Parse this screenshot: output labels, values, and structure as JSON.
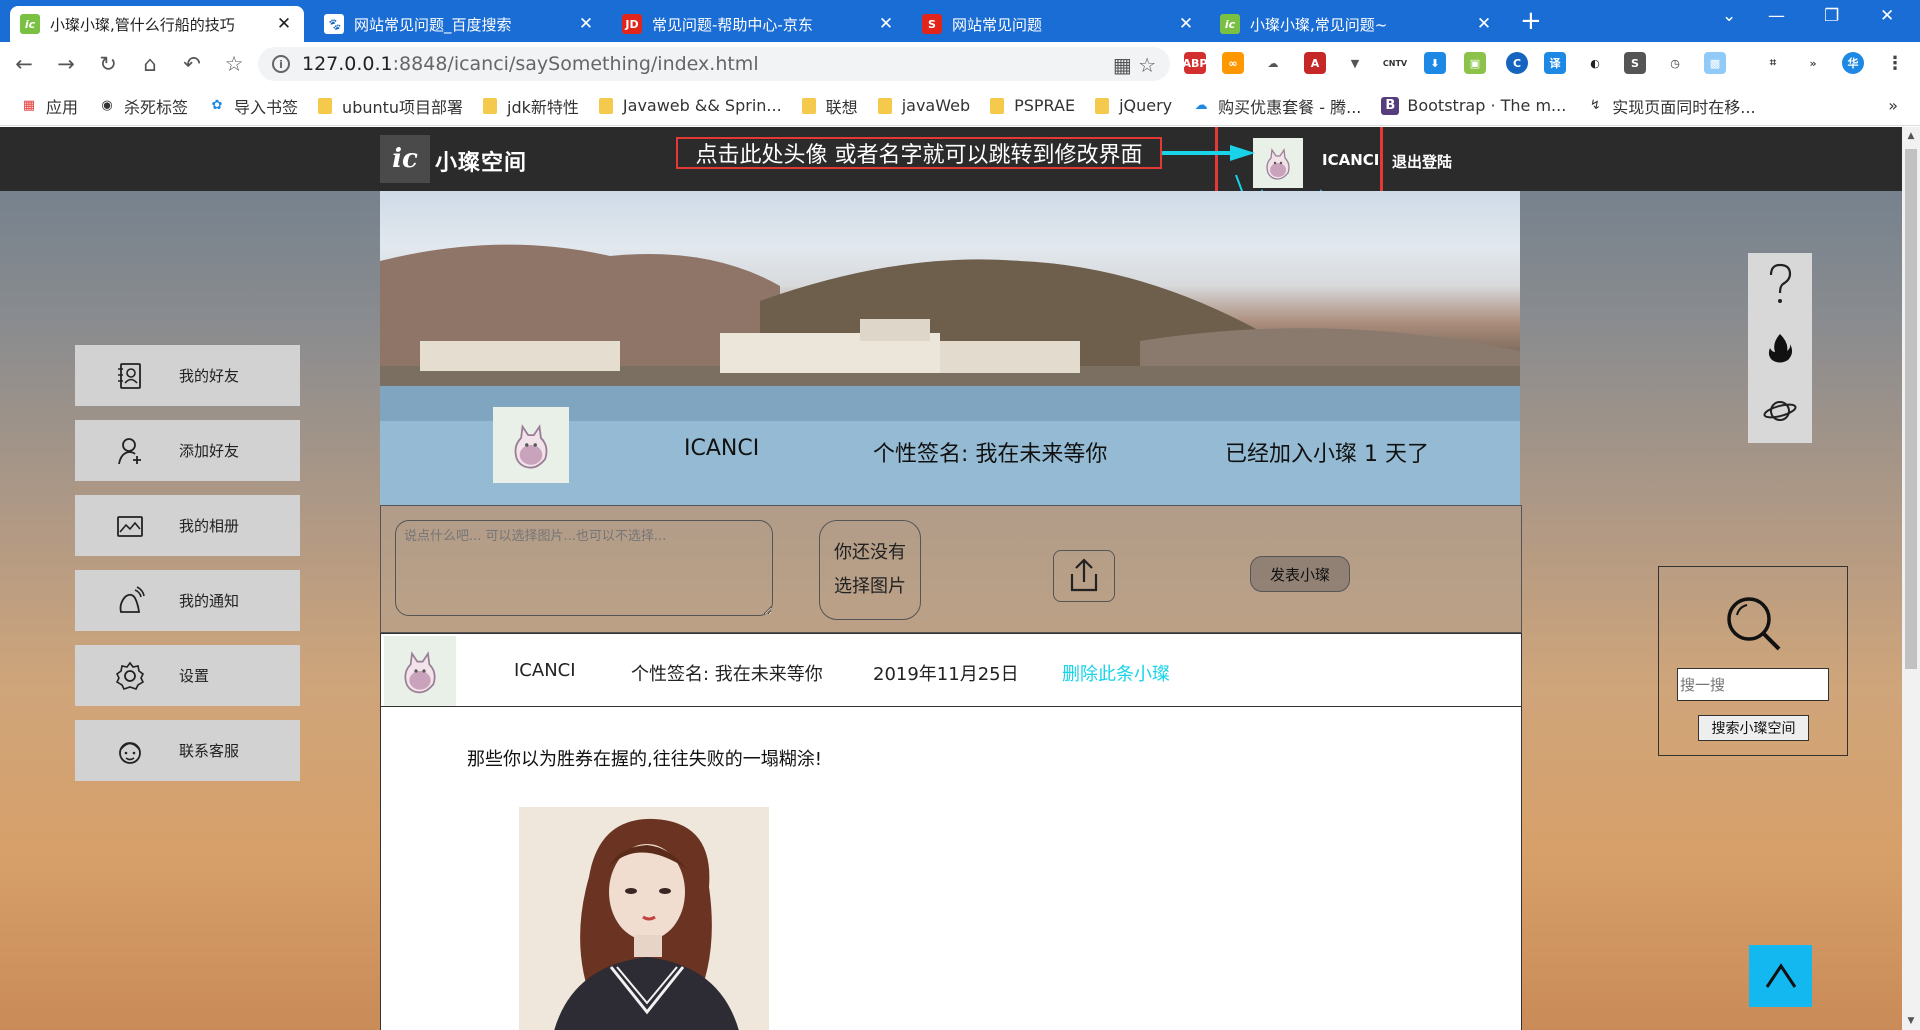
{
  "browser": {
    "tabs": [
      {
        "title": "小璨小璨,管什么行船的技巧",
        "favicon": "ic",
        "active": true
      },
      {
        "title": "网站常见问题_百度搜索",
        "favicon": "baidu",
        "active": false
      },
      {
        "title": "常见问题-帮助中心-京东",
        "favicon": "JD",
        "active": false
      },
      {
        "title": "网站常见问题",
        "favicon": "S",
        "active": false
      },
      {
        "title": "小璨小璨,常见问题~",
        "favicon": "ic",
        "active": false
      }
    ],
    "url_host": "127.0.0.1",
    "url_path": ":8848/icanci/saySomething/index.html",
    "bookmarks": [
      "应用",
      "杀死标签",
      "导入书签",
      "ubuntu项目部署",
      "jdk新特性",
      "Javaweb && Sprin...",
      "联想",
      "javaWeb",
      "PSPRAE",
      "jQuery",
      "购买优惠套餐 - 腾...",
      "Bootstrap · The m...",
      "实现页面同时在移..."
    ],
    "extension_labels": [
      "ABP",
      "CNTV",
      "S",
      "译",
      "华"
    ]
  },
  "site": {
    "logo_mark": "ic",
    "logo_text": "小璨空间",
    "annotation": "点击此处头像  或者名字就可以跳转到修改界面",
    "nav_user": "ICANCI",
    "logout": "退出登陆",
    "accent": "#19d3e8",
    "highlight_color": "#e53935"
  },
  "banner": {
    "name": "ICANCI",
    "signature": "个性签名: 我在未来等你",
    "days": "已经加入小璨 1 天了"
  },
  "post_form": {
    "placeholder": "说点什么吧... 可以选择图片...也可以不选择...",
    "pick_line1": "你还没有",
    "pick_line2": "选择图片",
    "publish": "发表小璨"
  },
  "post": {
    "name": "ICANCI",
    "signature": "个性签名: 我在未来等你",
    "date": "2019年11月25日",
    "delete": "删除此条小璨",
    "text": "那些你以为胜券在握的,往往失败的一塌糊涂!"
  },
  "sidebar": {
    "items": [
      {
        "label": "我的好友",
        "icon": "contacts-icon"
      },
      {
        "label": "添加好友",
        "icon": "add-user-icon"
      },
      {
        "label": "我的相册",
        "icon": "album-icon"
      },
      {
        "label": "我的通知",
        "icon": "notification-icon"
      },
      {
        "label": "设置",
        "icon": "settings-icon"
      },
      {
        "label": "联系客服",
        "icon": "customer-service-icon"
      }
    ]
  },
  "search": {
    "placeholder": "搜一搜",
    "button": "搜索小璨空间"
  }
}
